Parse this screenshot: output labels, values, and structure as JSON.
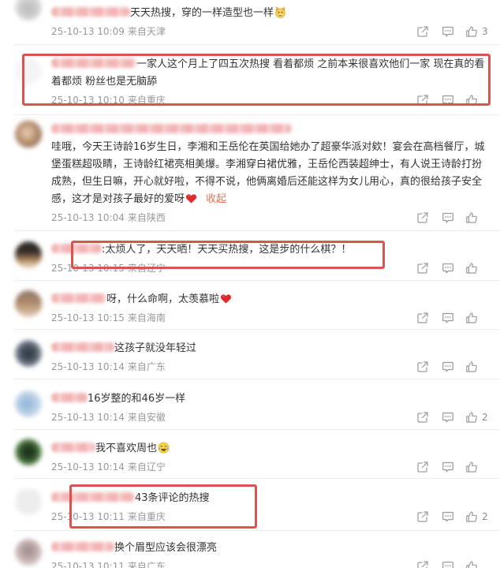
{
  "comments": [
    {
      "text": "天天热搜，穿的一样造型也一样",
      "emoji": "doge-emoji-icon",
      "time": "25-10-13 10:09",
      "location": "来自天津",
      "likes": "3"
    },
    {
      "lines": [
        "一家人这个月上了四五次热搜 看着都烦 之前本来很喜欢他们一家 现在真的看",
        "着都烦 粉丝也是无脑舔"
      ],
      "time": "25-10-13 10:10",
      "location": "来自重庆"
    },
    {
      "lines": [
        "哇哦，今天王诗龄16岁生日，李湘和王岳伦在英国给她办了超豪华派对欸！宴会在高档餐厅，城",
        "堡蛋糕超吸睛，王诗龄红裙亮相美爆。李湘穿白裙优雅，王岳伦西装超绅士，有人说王诗龄打扮",
        "成熟，但生日嘛，开心就好啦，不得不说，他俩离婚后还能这样为女儿用心，真的很给孩子安全",
        "感，这才是对孩子最好的爱呀"
      ],
      "emoji": "heart-emoji-icon",
      "collapse_label": "收起",
      "time": "25-10-13 10:04",
      "location": "来自陕西"
    },
    {
      "text": ":太烦人了，天天晒！天天买热搜，这是步的什么棋？！",
      "time": "25-10-13 10:15",
      "location": "来自辽宁"
    },
    {
      "text": "呀，什么命啊，太羡慕啦",
      "emoji": "heart-emoji-icon",
      "time": "25-10-13 10:15",
      "location": "来自海南"
    },
    {
      "text": "这孩子就没年轻过",
      "time": "25-10-13 10:14",
      "location": "来自广东"
    },
    {
      "text": "16岁整的和46岁一样",
      "time": "25-10-13 10:14",
      "location": "来自安徽",
      "likes": "2"
    },
    {
      "text": "我不喜欢周也",
      "emoji": "laugh-emoji-icon",
      "time": "25-10-13 10:14",
      "location": "来自辽宁"
    },
    {
      "text": "43条评论的热搜",
      "time": "25-10-13 10:11",
      "location": "来自重庆",
      "likes": "2"
    },
    {
      "text": "换个眉型应该会很漂亮",
      "time": "25-10-13 10:11",
      "location": "来自广东"
    }
  ],
  "action_icons": [
    "share-icon",
    "comment-icon",
    "like-icon"
  ],
  "colors": {
    "highlight_box": "#d9534f",
    "collapse_link": "#eb7350",
    "meta_text": "#999999",
    "body_text": "#333333"
  }
}
